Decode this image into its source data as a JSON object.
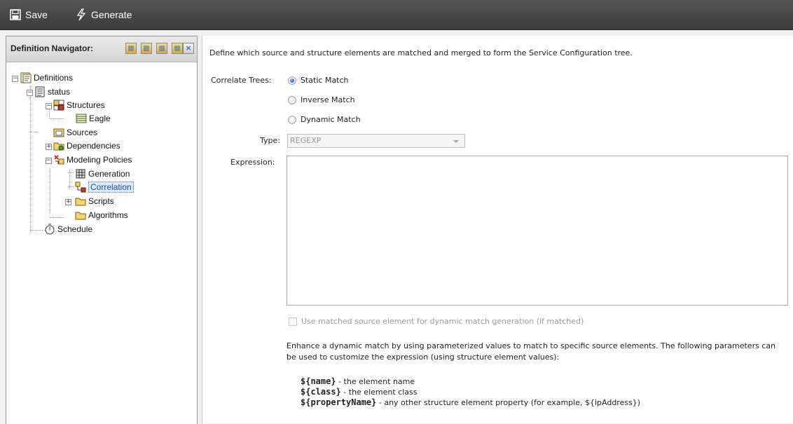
{
  "toolbar": {
    "save_label": "Save",
    "save_icon": "floppy-icon",
    "generate_label": "Generate",
    "generate_icon": "lightning-icon"
  },
  "navigator": {
    "title": "Definition Navigator:",
    "close_glyph": "×",
    "tree": [
      {
        "label": "Definitions",
        "icon": "definitions-icon"
      },
      {
        "label": "status",
        "icon": "document-icon"
      },
      {
        "label": "Structures",
        "icon": "structures-icon"
      },
      {
        "label": "Eagle",
        "icon": "table-icon"
      },
      {
        "label": "Sources",
        "icon": "sources-icon"
      },
      {
        "label": "Dependencies",
        "icon": "dependencies-icon"
      },
      {
        "label": "Modeling Policies",
        "icon": "policies-icon"
      },
      {
        "label": "Generation",
        "icon": "generation-icon"
      },
      {
        "label": "Correlation",
        "icon": "correlation-icon",
        "selected": true
      },
      {
        "label": "Scripts",
        "icon": "folder-icon"
      },
      {
        "label": "Algorithms",
        "icon": "folder-icon"
      },
      {
        "label": "Schedule",
        "icon": "stopwatch-icon"
      }
    ]
  },
  "main": {
    "description": "Define which source and structure elements are matched and merged to form the Service Configuration tree.",
    "correlate_label": "Correlate Trees:",
    "radios": [
      {
        "label": "Static Match",
        "checked": true
      },
      {
        "label": "Inverse Match",
        "checked": false
      },
      {
        "label": "Dynamic Match",
        "checked": false
      }
    ],
    "type_label": "Type:",
    "type_value": "REGEXP",
    "expression_label": "Expression:",
    "expression_value": "",
    "checkbox_label": "Use matched source element for dynamic match generation (if matched)",
    "help_text": "Enhance a dynamic match by using parameterized values to match to specific source elements. The following parameters can be used to customize the expression (using structure element values):",
    "params": [
      {
        "token": "${name}",
        "desc": " - the element name"
      },
      {
        "token": "${class}",
        "desc": " - the element class"
      },
      {
        "token": "${propertyName}",
        "desc": " - any other structure element property (for example, ${ipAddress})"
      }
    ]
  }
}
